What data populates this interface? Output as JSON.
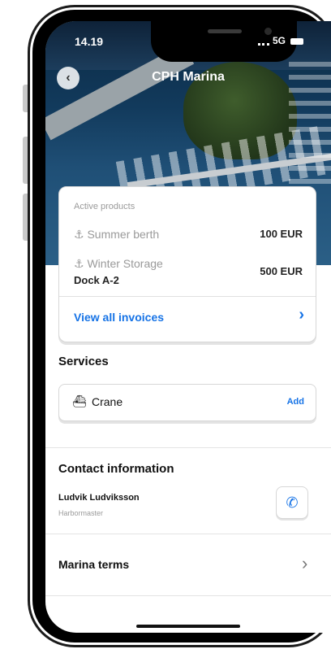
{
  "status": {
    "time": "14.19",
    "network": "5G"
  },
  "header": {
    "title": "CPH Marina"
  },
  "active_products": {
    "heading": "Active products",
    "items": [
      {
        "label": "Summer berth",
        "price": "100 EUR",
        "icon": "berth-icon"
      },
      {
        "label": "Winter Storage",
        "sublabel": "Dock A-2",
        "price": "500 EUR",
        "icon": "anchor-icon"
      }
    ],
    "view_invoices_label": "View all invoices"
  },
  "services": {
    "title": "Services",
    "items": [
      {
        "name": "Crane",
        "action": "Add",
        "icon": "crane-icon"
      }
    ]
  },
  "contact": {
    "title": "Contact information",
    "name": "Ludvik Ludviksson",
    "role": "Harbormaster"
  },
  "terms": {
    "label": "Marina terms"
  },
  "colors": {
    "accent": "#1673e6",
    "muted": "#9a9a9a"
  }
}
